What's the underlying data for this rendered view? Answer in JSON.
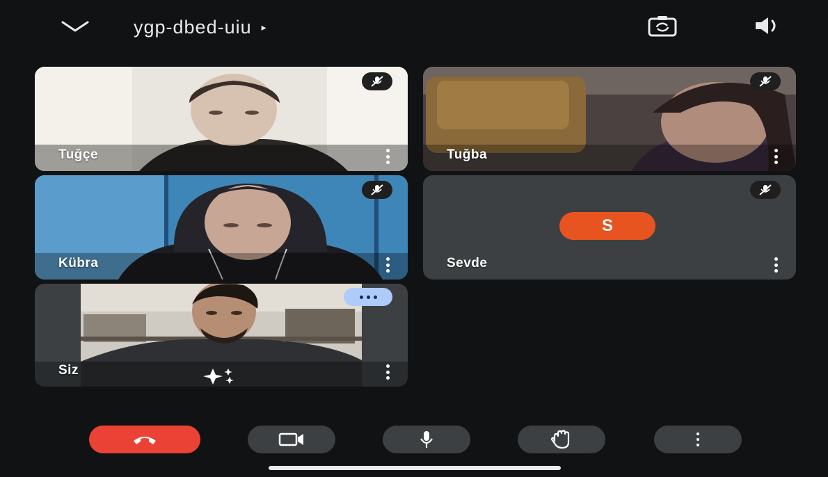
{
  "meeting": {
    "code": "ygp-dbed-uiu",
    "play_glyph": "▸"
  },
  "icons": {
    "collapse": "chevron-down-icon",
    "switch_camera": "switch-camera-icon",
    "speaker": "speaker-icon",
    "muted": "mic-off-icon",
    "more": "more-vert-icon"
  },
  "participants": [
    {
      "name": "Tuğçe",
      "muted": true
    },
    {
      "name": "Tuğba",
      "muted": true
    },
    {
      "name": "Kübra",
      "muted": true
    },
    {
      "name": "Sevde",
      "muted": true,
      "avatar_letter": "S",
      "avatar_color": "#e8541f"
    },
    {
      "name": "Siz",
      "self": true,
      "effects_icon": "sparkle-icon"
    }
  ],
  "controls": [
    "end-call",
    "camera",
    "microphone",
    "raise-hand",
    "more-options"
  ],
  "colors": {
    "end_call": "#ea4335",
    "tile_bg": "#3c4043",
    "self_badge": "#aecbfa"
  }
}
